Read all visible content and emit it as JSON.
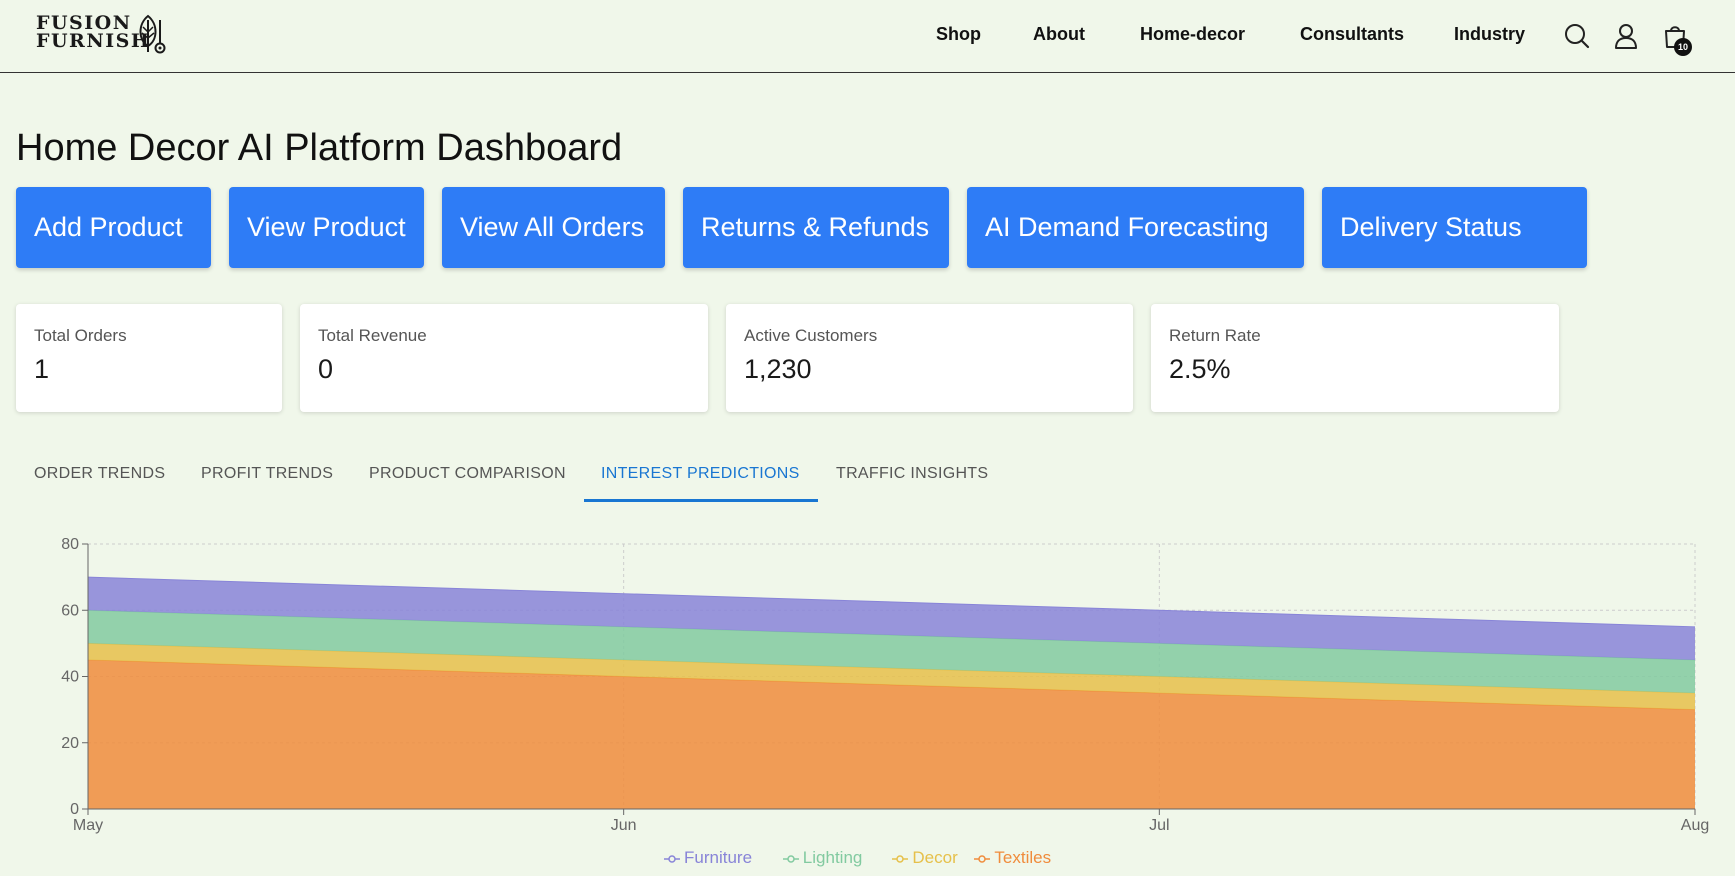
{
  "header": {
    "logo_line1": "FUSION",
    "logo_line2": "FURNISH",
    "nav": [
      "Shop",
      "About",
      "Home-decor",
      "Consultants",
      "Industry"
    ],
    "cart_count": "10"
  },
  "page": {
    "title": "Home Decor AI Platform Dashboard"
  },
  "actions": [
    "Add Product",
    "View Product",
    "View All Orders",
    "Returns & Refunds",
    "AI Demand Forecasting",
    "Delivery Status"
  ],
  "stats": [
    {
      "label": "Total Orders",
      "value": "1"
    },
    {
      "label": "Total Revenue",
      "value": "0"
    },
    {
      "label": "Active Customers",
      "value": "1,230"
    },
    {
      "label": "Return Rate",
      "value": "2.5%"
    }
  ],
  "tabs": [
    "ORDER TRENDS",
    "PROFIT TRENDS",
    "PRODUCT COMPARISON",
    "INTEREST PREDICTIONS",
    "TRAFFIC INSIGHTS"
  ],
  "active_tab": "INTEREST PREDICTIONS",
  "colors": {
    "accent": "#2e7cf6",
    "tab_active": "#1976d2",
    "background": "#f0f7ea"
  },
  "chart_data": {
    "type": "area",
    "stacked": true,
    "categories": [
      "May",
      "Jun",
      "Jul",
      "Aug"
    ],
    "ylim": [
      0,
      80
    ],
    "yticks": [
      0,
      20,
      40,
      60,
      80
    ],
    "grid": true,
    "legend_position": "bottom",
    "series": [
      {
        "name": "Textiles",
        "color": "#f08c3c",
        "values": [
          45,
          40,
          35,
          30
        ]
      },
      {
        "name": "Decor",
        "color": "#e6c04a",
        "values": [
          5,
          5,
          5,
          5
        ]
      },
      {
        "name": "Lighting",
        "color": "#82caa0",
        "values": [
          10,
          10,
          10,
          10
        ]
      },
      {
        "name": "Furniture",
        "color": "#8884d8",
        "values": [
          10,
          10,
          10,
          10
        ]
      }
    ],
    "legend_order": [
      "Furniture",
      "Lighting",
      "Decor",
      "Textiles"
    ]
  }
}
